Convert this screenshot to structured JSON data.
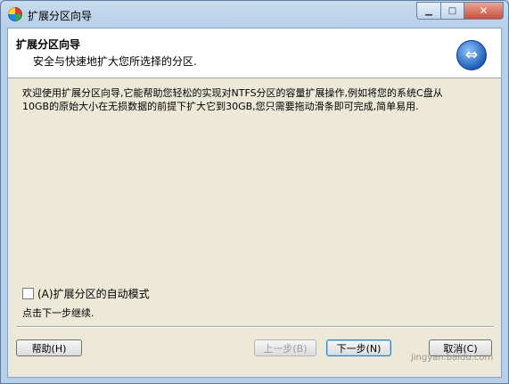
{
  "window": {
    "title": "扩展分区向导",
    "minimize_glyph": "▁",
    "maximize_glyph": "□",
    "close_glyph": "✕"
  },
  "header": {
    "title": "扩展分区向导",
    "subtitle": "安全与快速地扩大您所选择的分区.",
    "icon": "expand-arrows-icon",
    "icon_glyph": "⇔"
  },
  "body": {
    "description": "欢迎使用扩展分区向导,它能帮助您轻松的实现对NTFS分区的容量扩展操作,例如将您的系统C盘从10GB的原始大小在无损数据的前提下扩大它到30GB,您只需要拖动滑条即可完成,简单易用.",
    "auto_mode_label": "(A)扩展分区的自动模式",
    "auto_mode_checked": false,
    "hint": "点击下一步继续."
  },
  "buttons": {
    "help": "帮助(H)",
    "back": "上一步(B)",
    "next": "下一步(N)",
    "cancel": "取消(C)"
  },
  "watermark": "jingyan.baidu.com"
}
